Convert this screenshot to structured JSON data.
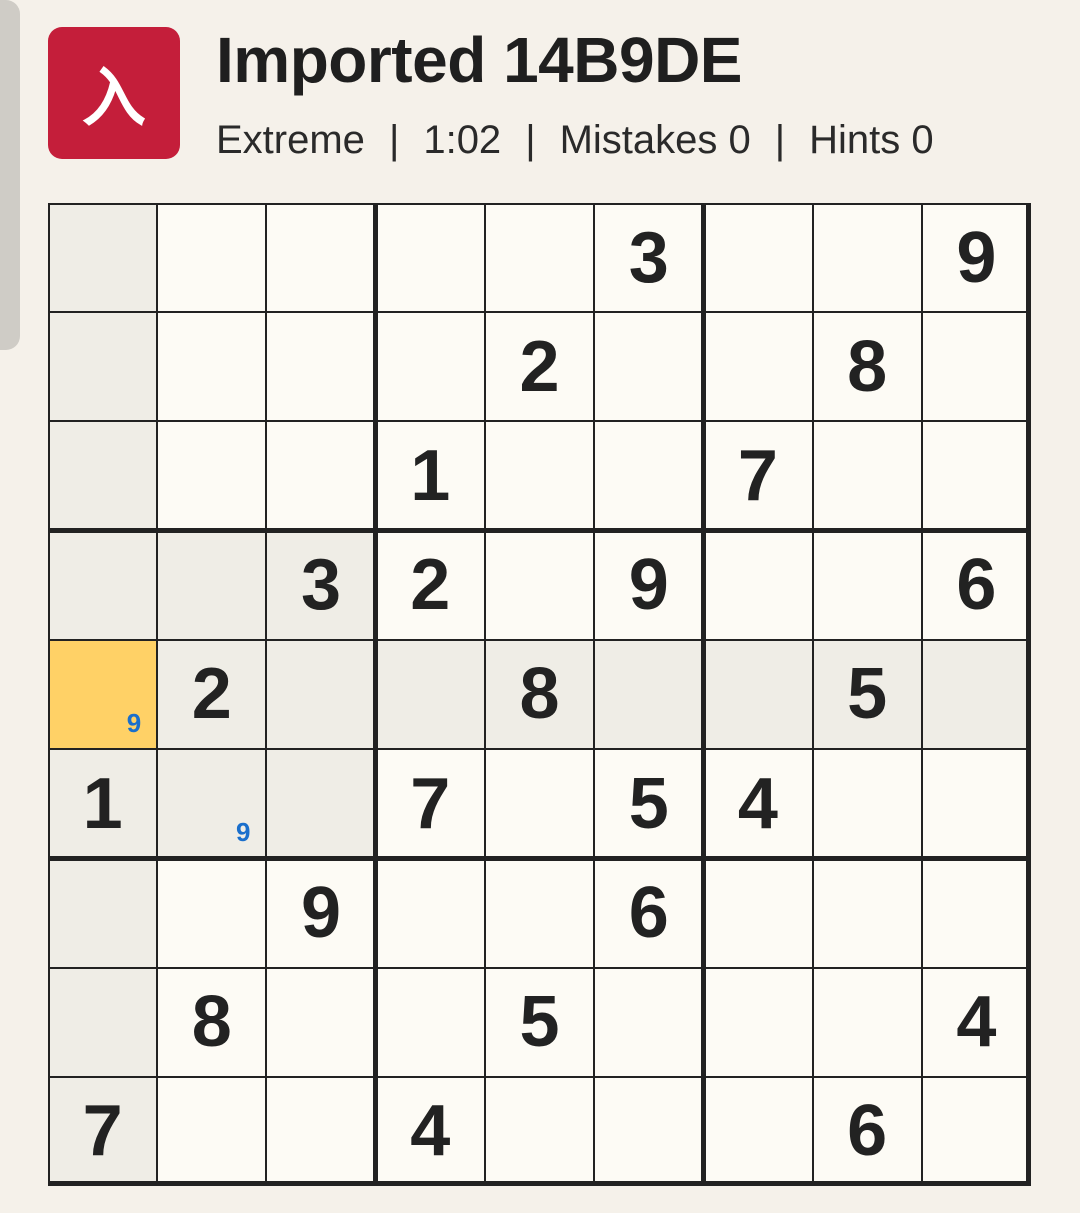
{
  "header": {
    "icon_glyph": "入",
    "icon_name": "app-kanji-icon",
    "icon_color": "#c41e3a",
    "title": "Imported 14B9DE",
    "difficulty": "Extreme",
    "timer": "1:02",
    "mistakes": "Mistakes 0",
    "hints": "Hints 0",
    "separator": "|"
  },
  "board": {
    "selected": [
      4,
      0
    ],
    "highlight_color": "#ffd166",
    "peer_color": "#efede6",
    "note_color": "#1a6fcc",
    "cells": [
      [
        "",
        "",
        "",
        "",
        "",
        "3",
        "",
        "",
        "9"
      ],
      [
        "",
        "",
        "",
        "",
        "2",
        "",
        "",
        "8",
        ""
      ],
      [
        "",
        "",
        "",
        "1",
        "",
        "",
        "7",
        "",
        ""
      ],
      [
        "",
        "",
        "3",
        "2",
        "",
        "9",
        "",
        "",
        "6"
      ],
      [
        "",
        "2",
        "",
        "",
        "8",
        "",
        "",
        "5",
        ""
      ],
      [
        "1",
        "",
        "",
        "7",
        "",
        "5",
        "4",
        "",
        ""
      ],
      [
        "",
        "",
        "9",
        "",
        "",
        "6",
        "",
        "",
        ""
      ],
      [
        "",
        "8",
        "",
        "",
        "5",
        "",
        "",
        "",
        "4"
      ],
      [
        "7",
        "",
        "",
        "4",
        "",
        "",
        "",
        "6",
        ""
      ]
    ],
    "notes": [
      {
        "row": 4,
        "col": 0,
        "value": "9"
      },
      {
        "row": 5,
        "col": 1,
        "value": "9"
      }
    ]
  }
}
